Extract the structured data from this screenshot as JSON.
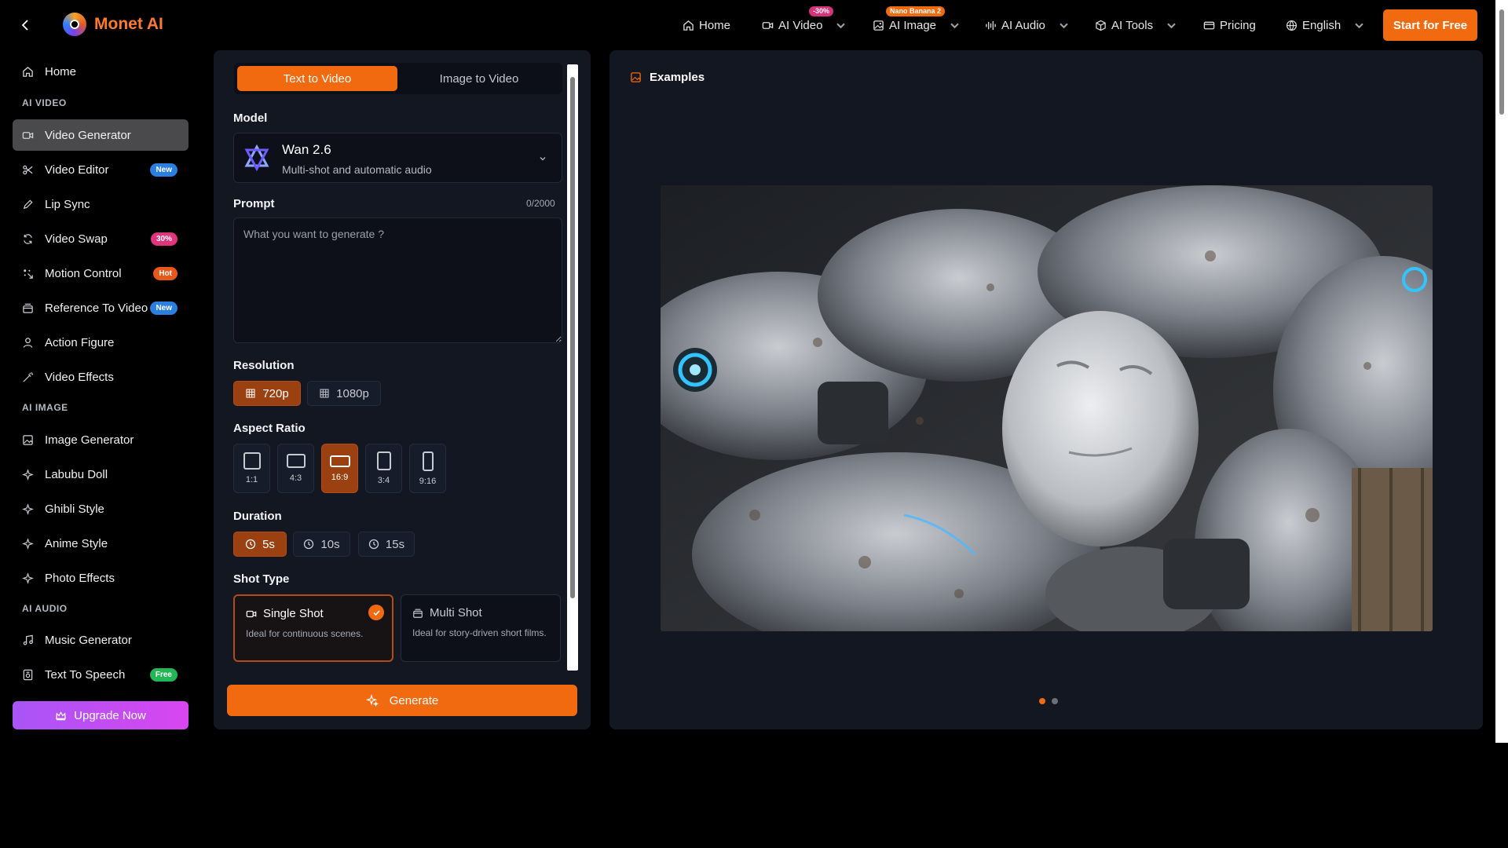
{
  "app": {
    "name": "Monet AI"
  },
  "nav": {
    "home": "Home",
    "ai_video": "AI Video",
    "ai_video_badge": "-30%",
    "ai_image": "AI Image",
    "ai_image_badge": "Nano Banana 2",
    "ai_audio": "AI Audio",
    "ai_tools": "AI Tools",
    "pricing": "Pricing",
    "language": "English",
    "cta": "Start for Free"
  },
  "sidebar": {
    "home": "Home",
    "sections": [
      "AI VIDEO",
      "AI IMAGE",
      "AI AUDIO"
    ],
    "video_items": [
      {
        "label": "Video Generator",
        "icon": "video-camera-icon",
        "active": true
      },
      {
        "label": "Video Editor",
        "icon": "scissors-icon",
        "badge": "New"
      },
      {
        "label": "Lip Sync",
        "icon": "pen-icon"
      },
      {
        "label": "Video Swap",
        "icon": "swap-icon",
        "badge": "30%"
      },
      {
        "label": "Motion Control",
        "icon": "motion-icon",
        "badge": "Hot"
      },
      {
        "label": "Reference To Video",
        "icon": "stack-icon",
        "badge": "New"
      },
      {
        "label": "Action Figure",
        "icon": "user-icon"
      },
      {
        "label": "Video Effects",
        "icon": "magic-wand-icon"
      }
    ],
    "image_items": [
      {
        "label": "Image Generator",
        "icon": "image-edit-icon"
      },
      {
        "label": "Labubu Doll",
        "icon": "sparkle-icon"
      },
      {
        "label": "Ghibli Style",
        "icon": "sparkle-icon"
      },
      {
        "label": "Anime Style",
        "icon": "sparkle-icon"
      },
      {
        "label": "Photo Effects",
        "icon": "sparkle-icon"
      }
    ],
    "audio_items": [
      {
        "label": "Music Generator",
        "icon": "music-note-icon"
      },
      {
        "label": "Text To Speech",
        "icon": "speech-icon",
        "badge": "Free"
      }
    ],
    "upgrade": "Upgrade Now"
  },
  "form": {
    "tabs": [
      "Text to Video",
      "Image to Video"
    ],
    "model_label": "Model",
    "model_name": "Wan 2.6",
    "model_desc": "Multi-shot and automatic audio",
    "prompt_label": "Prompt",
    "prompt_counter": "0/2000",
    "prompt_placeholder": "What you want to generate ?",
    "resolution_label": "Resolution",
    "resolutions": [
      "720p",
      "1080p"
    ],
    "aspect_label": "Aspect Ratio",
    "aspects": [
      "1:1",
      "4:3",
      "16:9",
      "3:4",
      "9:16"
    ],
    "duration_label": "Duration",
    "durations": [
      "5s",
      "10s",
      "15s"
    ],
    "shot_label": "Shot Type",
    "shots": [
      {
        "title": "Single Shot",
        "desc": "Ideal for continuous scenes."
      },
      {
        "title": "Multi Shot",
        "desc": "Ideal for story-driven short films."
      }
    ],
    "generate": "Generate"
  },
  "examples": {
    "title": "Examples",
    "slides": 2,
    "current": 1
  },
  "colors": {
    "accent": "#f26a10",
    "panel": "#131722",
    "upgrade": "#c04ff0"
  }
}
